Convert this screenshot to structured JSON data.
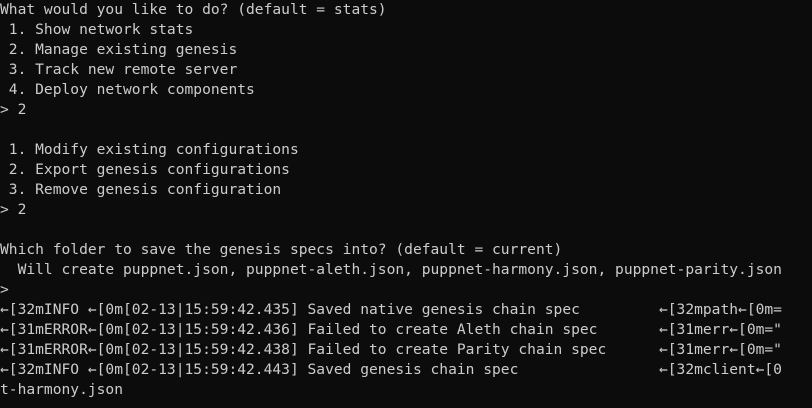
{
  "terminal": {
    "lines": [
      "What would you like to do? (default = stats)",
      " 1. Show network stats",
      " 2. Manage existing genesis",
      " 3. Track new remote server",
      " 4. Deploy network components",
      "> 2",
      "",
      " 1. Modify existing configurations",
      " 2. Export genesis configurations",
      " 3. Remove genesis configuration",
      "> 2",
      "",
      "Which folder to save the genesis specs into? (default = current)",
      "  Will create puppnet.json, puppnet-aleth.json, puppnet-harmony.json, puppnet-parity.json",
      ">",
      "←[32mINFO ←[0m[02-13|15:59:42.435] Saved native genesis chain spec         ←[32mpath←[0m=",
      "←[31mERROR←[0m[02-13|15:59:42.436] Failed to create Aleth chain spec       ←[31merr←[0m=\"",
      "←[31mERROR←[0m[02-13|15:59:42.438] Failed to create Parity chain spec      ←[31merr←[0m=\"",
      "←[32mINFO ←[0m[02-13|15:59:42.443] Saved genesis chain spec                ←[32mclient←[0",
      "t-harmony.json"
    ]
  }
}
